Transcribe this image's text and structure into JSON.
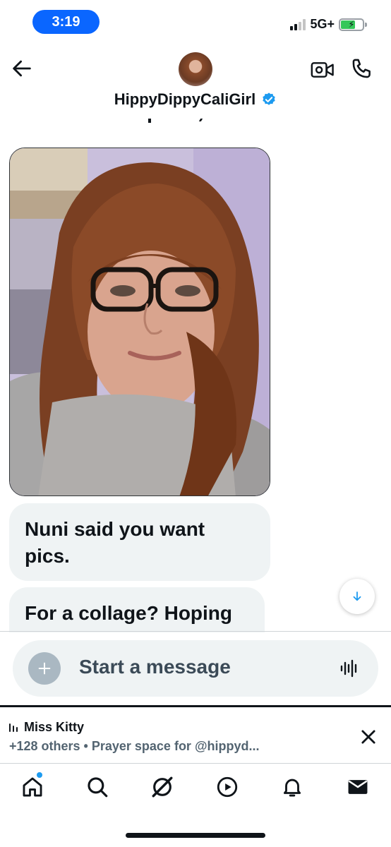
{
  "status_bar": {
    "time": "3:19",
    "network": "5G+",
    "battery_bolt": "⚡"
  },
  "header": {
    "display_name": "HippyDippyCaliGirl",
    "icons": [
      "back-arrow-icon",
      "video-camera-icon",
      "phone-icon",
      "verified-badge-icon"
    ],
    "accent": "#1d9bf0"
  },
  "messages": [
    {
      "type": "photo",
      "alt": "selfie"
    },
    {
      "type": "text",
      "text": "Nuni said you want pics."
    },
    {
      "type": "text",
      "text": "For a collage? Hoping"
    }
  ],
  "composer": {
    "placeholder": "Start a message",
    "add_symbol": "+"
  },
  "space_bar": {
    "host": "Miss Kitty",
    "subtitle": "+128 others • Prayer space for @hippyd..."
  },
  "tab_bar": {
    "icons": [
      "home-icon",
      "search-icon",
      "grok-icon",
      "video-icon",
      "notifications-icon",
      "messages-icon"
    ]
  }
}
